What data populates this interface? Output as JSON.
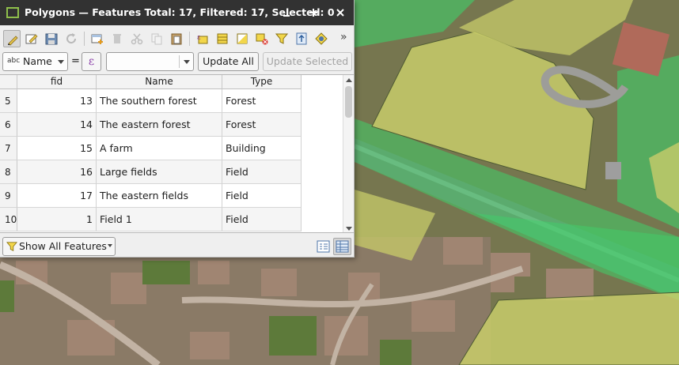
{
  "window": {
    "title": "Polygons — Features Total: 17, Filtered: 17, Selected: 0",
    "minimize_icon": "minimize-icon",
    "maximize_icon": "maximize-icon",
    "close_icon": "close-icon"
  },
  "toolbar": {
    "items": [
      "toggle-editing-icon",
      "multi-edit-icon",
      "save-edits-icon",
      "reload-icon",
      "add-feature-icon",
      "delete-feature-icon",
      "cut-icon",
      "copy-icon",
      "paste-icon",
      "select-by-expression-icon",
      "select-all-icon",
      "invert-selection-icon",
      "deselect-icon",
      "filter-icon",
      "move-selection-to-top-icon",
      "zoom-to-selection-icon",
      "more-icon"
    ],
    "overflow_label": "»"
  },
  "field_bar": {
    "field_prefix": "abc",
    "field_value": "Name",
    "equals_label": "=",
    "expression_label": "ε",
    "value_input": "",
    "update_all_label": "Update All",
    "update_selected_label": "Update Selected"
  },
  "table": {
    "columns": [
      "fid",
      "Name",
      "Type"
    ],
    "rows": [
      {
        "index": "5",
        "fid": "13",
        "name": "The southern forest",
        "type": "Forest"
      },
      {
        "index": "6",
        "fid": "14",
        "name": "The eastern forest",
        "type": "Forest"
      },
      {
        "index": "7",
        "fid": "15",
        "name": "A farm",
        "type": "Building"
      },
      {
        "index": "8",
        "fid": "16",
        "name": "Large fields",
        "type": "Field"
      },
      {
        "index": "9",
        "fid": "17",
        "name": "The eastern fields",
        "type": "Field"
      },
      {
        "index": "10",
        "fid": "1",
        "name": "Field 1",
        "type": "Field"
      }
    ]
  },
  "bottom_bar": {
    "show_features_label": "Show All Features",
    "form_view_icon": "form-view-icon",
    "table_view_icon": "table-view-icon"
  },
  "colors": {
    "titlebar": "#323232",
    "field_polygon": "#c8cc6a",
    "forest_polygon": "#3fcf6a"
  }
}
